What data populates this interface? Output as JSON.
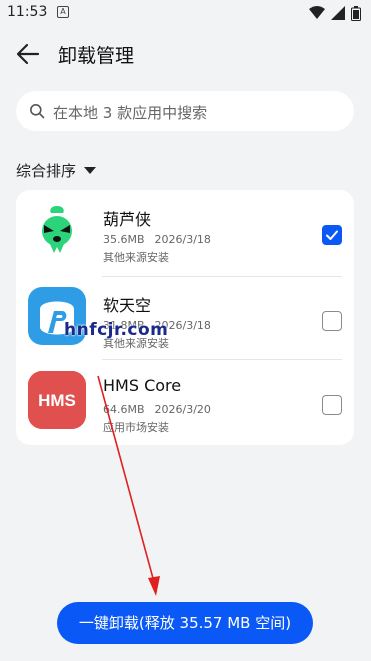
{
  "status_bar": {
    "time": "11:53",
    "notification_icon": "A"
  },
  "header": {
    "title": "卸载管理"
  },
  "search": {
    "placeholder": "在本地 3 款应用中搜索"
  },
  "sort": {
    "label": "综合排序"
  },
  "apps": [
    {
      "name": "葫芦侠",
      "size": "35.6MB",
      "date": "2026/3/18",
      "source": "其他来源安装",
      "checked": true,
      "icon": "huluxia-icon",
      "color": "#2bd47a"
    },
    {
      "name": "软天空",
      "size": "31.8MB",
      "date": "2026/3/18",
      "source": "其他来源安装",
      "checked": false,
      "icon": "ruantiankong-icon",
      "color": "#2e9de6"
    },
    {
      "name": "HMS Core",
      "size": "64.6MB",
      "date": "2026/3/20",
      "source": "应用市场安装",
      "checked": false,
      "icon": "hms-core-icon",
      "color": "#e0504e"
    }
  ],
  "hms_icon_text": "HMS",
  "watermark": "hnfcjr.com",
  "uninstall_button": {
    "label": "一键卸载(释放 35.57 MB 空间)"
  },
  "colors": {
    "accent": "#0a59f7",
    "background": "#f1f3f5",
    "annotation_arrow": "#e02020"
  }
}
